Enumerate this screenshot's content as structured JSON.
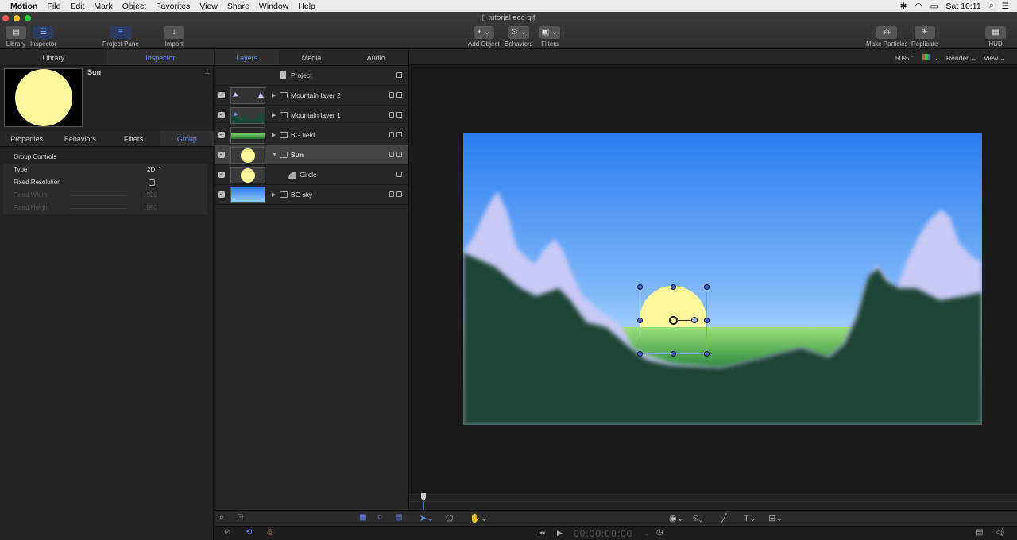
{
  "menubar": {
    "app": "Motion",
    "items": [
      "File",
      "Edit",
      "Mark",
      "Object",
      "Favorites",
      "View",
      "Share",
      "Window",
      "Help"
    ],
    "clock": "Sat 10:11"
  },
  "window": {
    "title": "tutorial eco gif"
  },
  "toolbar": {
    "library": "Library",
    "inspector": "Inspector",
    "project_pane": "Project Pane",
    "import": "Import",
    "add_object": "Add Object",
    "behaviors": "Behaviors",
    "filters": "Filters",
    "make_particles": "Make Particles",
    "replicate": "Replicate",
    "hud": "HUD"
  },
  "left_tabs": [
    "Library",
    "Inspector"
  ],
  "inspector": {
    "object_name": "Sun",
    "tabs": [
      "Properties",
      "Behaviors",
      "Filters",
      "Group"
    ],
    "section": "Group Controls",
    "rows": [
      {
        "label": "Type",
        "value": "2D"
      },
      {
        "label": "Fixed Resolution",
        "value": ""
      },
      {
        "label": "Fixed Width",
        "value": "1920"
      },
      {
        "label": "Fixed Height",
        "value": "1080"
      }
    ]
  },
  "layers_tabs": [
    "Layers",
    "Media",
    "Audio"
  ],
  "layers": {
    "project": "Project",
    "rows": [
      {
        "name": "Mountain layer 2"
      },
      {
        "name": "Mountain layer 1"
      },
      {
        "name": "BG field"
      },
      {
        "name": "Sun"
      },
      {
        "name": "Circle"
      },
      {
        "name": "BG sky"
      }
    ]
  },
  "canvas_bar": {
    "zoom": "50%",
    "render": "Render",
    "view": "View"
  },
  "timecode": "00:00:00:00",
  "colors": {
    "accent": "#6b8dff",
    "sun": "#fff89c",
    "sky_top": "#2b7cf0",
    "grass": "#1d5e2c"
  }
}
